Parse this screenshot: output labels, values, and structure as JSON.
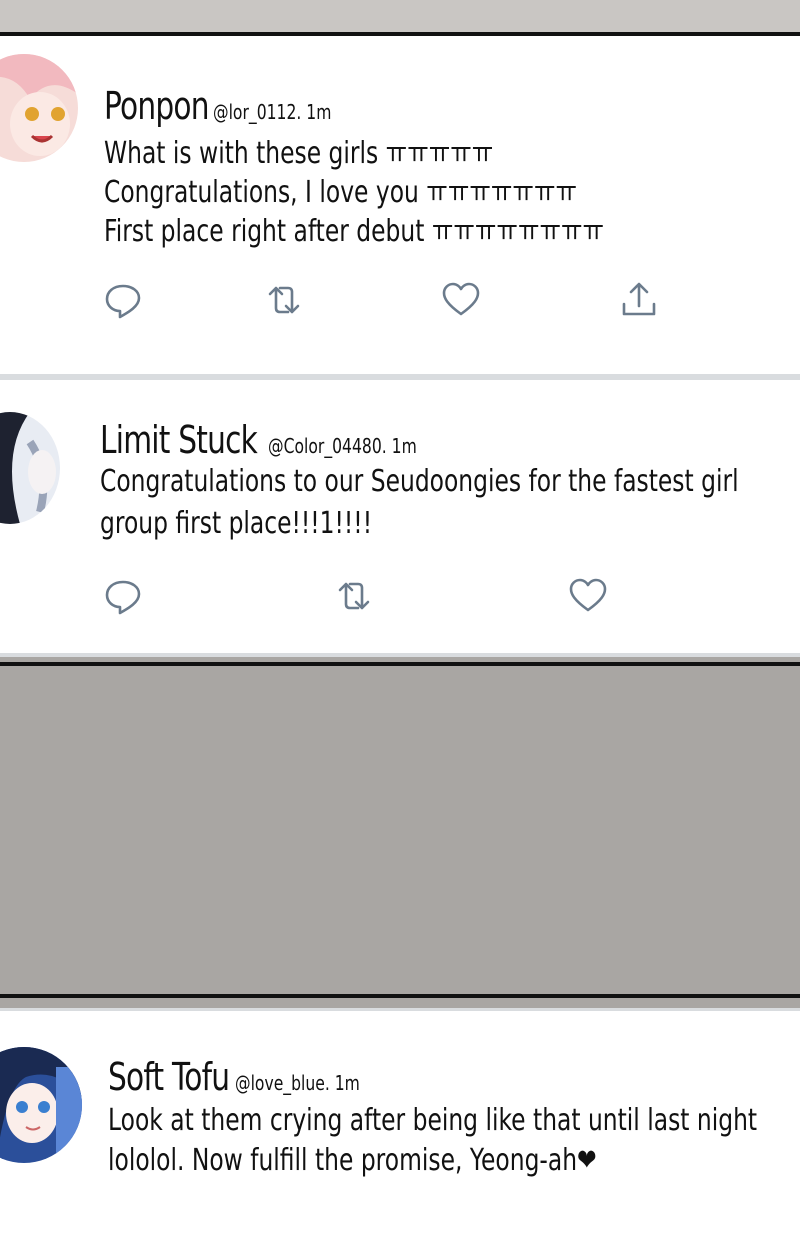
{
  "posts": [
    {
      "name": "Ponpon",
      "handle": "@lor_0112. 1m",
      "lines": [
        "What is with these girls ㅠㅠㅠㅠㅠ",
        "Congratulations, I love you ㅠㅠㅠㅠㅠㅠㅠ",
        "First place right after debut ㅠㅠㅠㅠㅠㅠㅠㅠ"
      ],
      "actions": [
        "reply-icon",
        "retweet-icon",
        "like-icon",
        "share-icon"
      ]
    },
    {
      "name": "Limit Stuck",
      "handle": "@Color_04480. 1m",
      "lines": [
        "Congratulations to our Seudoongies for the fastest girl",
        "group first place!!!1!!!!"
      ],
      "actions": [
        "reply-icon",
        "retweet-icon",
        "like-icon"
      ]
    },
    {
      "name": "Soft Tofu",
      "handle": "@love_blue. 1m",
      "lines": [
        "Look at them crying after being like that until last night",
        "lololol. Now fulfill the promise, Yeong-ah❤"
      ]
    }
  ],
  "colors": {
    "card_bg": "#ffffff",
    "gray_panel": "#a9a6a3",
    "icon_gray": "#6b7b8c"
  }
}
